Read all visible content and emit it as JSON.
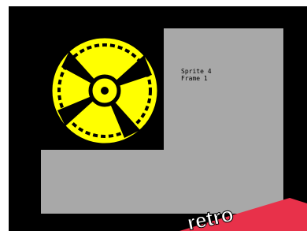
{
  "colors": {
    "background": "#000000",
    "panel": "#a8a8a8",
    "sprite_fill": "#ffff00",
    "sprite_outline": "#000000",
    "logo_banner": "#e8314a",
    "logo_text": "#ffffff"
  },
  "info": {
    "sprite_label": "Sprite 4",
    "frame_label": "Frame 1"
  },
  "logo": {
    "text": "retro"
  }
}
